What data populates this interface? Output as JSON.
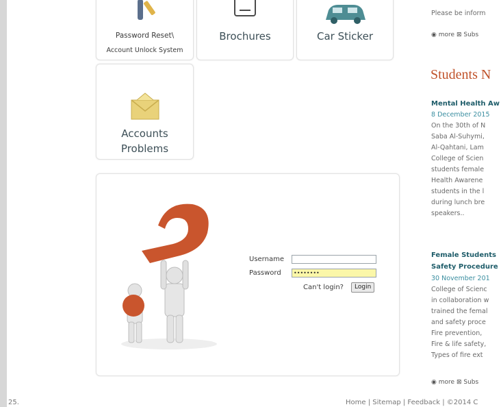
{
  "tiles": {
    "password_reset": [
      "Password Reset\\",
      "Account Unlock System"
    ],
    "brochures": "Brochures",
    "car_sticker": "Car Sticker",
    "accounts_problems": [
      "Accounts",
      "Problems"
    ]
  },
  "login": {
    "username_label": "Username",
    "password_label": "Password",
    "username_value": "",
    "password_value": "••••••••",
    "cant_login": "Can't login?",
    "login_button": "Login"
  },
  "sidebar": {
    "top_text": "Please be inform",
    "more_label": "more",
    "subscribe_label": "Subs",
    "section_title": "Students N",
    "news": [
      {
        "title": [
          "Mental Health Aw"
        ],
        "date": "8 December 2015",
        "lines": [
          "On the 30th of N",
          "Saba Al-Suhymi, ",
          "Al-Qahtani, Lam",
          "College of Scien",
          "students female ",
          "Health Awarene",
          "students in the l",
          "during lunch bre",
          "speakers.."
        ]
      },
      {
        "title": [
          "Female Students",
          "Safety Procedure"
        ],
        "date": "30 November 201",
        "lines": [
          "College of Scienc",
          "in collaboration w",
          "trained the femal",
          "and safety proce",
          "Fire prevention, ",
          "Fire & life safety, ",
          "Types of fire ext"
        ]
      }
    ]
  },
  "footer": {
    "left": "25.",
    "links": "Home | Sitemap | Feedback | ©2014 C"
  },
  "colors": {
    "accent": "#c0522a",
    "news_title": "#1f5d6a",
    "news_date": "#3a8ea0",
    "password_field": "#fbf7a8"
  }
}
